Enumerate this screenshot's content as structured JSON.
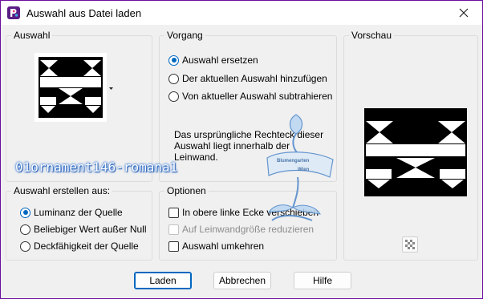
{
  "window": {
    "title": "Auswahl aus Datei laden"
  },
  "groups": {
    "auswahl": "Auswahl",
    "vorgang": "Vorgang",
    "vorschau": "Vorschau",
    "erstellen": "Auswahl erstellen aus:",
    "optionen": "Optionen"
  },
  "vorgang_options": [
    {
      "label": "Auswahl ersetzen",
      "checked": true
    },
    {
      "label": "Der aktuellen Auswahl hinzufügen",
      "checked": false
    },
    {
      "label": "Von aktueller Auswahl subtrahieren",
      "checked": false
    }
  ],
  "info": {
    "line1": "Das ursprüngliche Rechteck dieser",
    "line2": "Auswahl liegt innerhalb der",
    "line3": "Leinwand."
  },
  "erstellen_options": [
    {
      "label": "Luminanz der Quelle",
      "checked": true
    },
    {
      "label": "Beliebiger Wert außer Null",
      "checked": false
    },
    {
      "label": "Deckfähigkeit der Quelle",
      "checked": false
    }
  ],
  "optionen_items": [
    {
      "label": "In obere linke Ecke verschieben",
      "checked": false,
      "disabled": false
    },
    {
      "label": "Auf Leinwandgröße reduzieren",
      "checked": false,
      "disabled": true
    },
    {
      "label": "Auswahl umkehren",
      "checked": false,
      "disabled": false
    }
  ],
  "selection_file_name": "01ornament146-romana1",
  "stamp": {
    "text1": "Blumengarten",
    "text2": "Wien"
  },
  "buttons": {
    "load": "Laden",
    "cancel": "Abbrechen",
    "help": "Hilfe"
  },
  "colors": {
    "titlebar_frame": "#6a0d9e",
    "accent": "#0067c0",
    "dialog_bg": "#f0f0f0"
  }
}
